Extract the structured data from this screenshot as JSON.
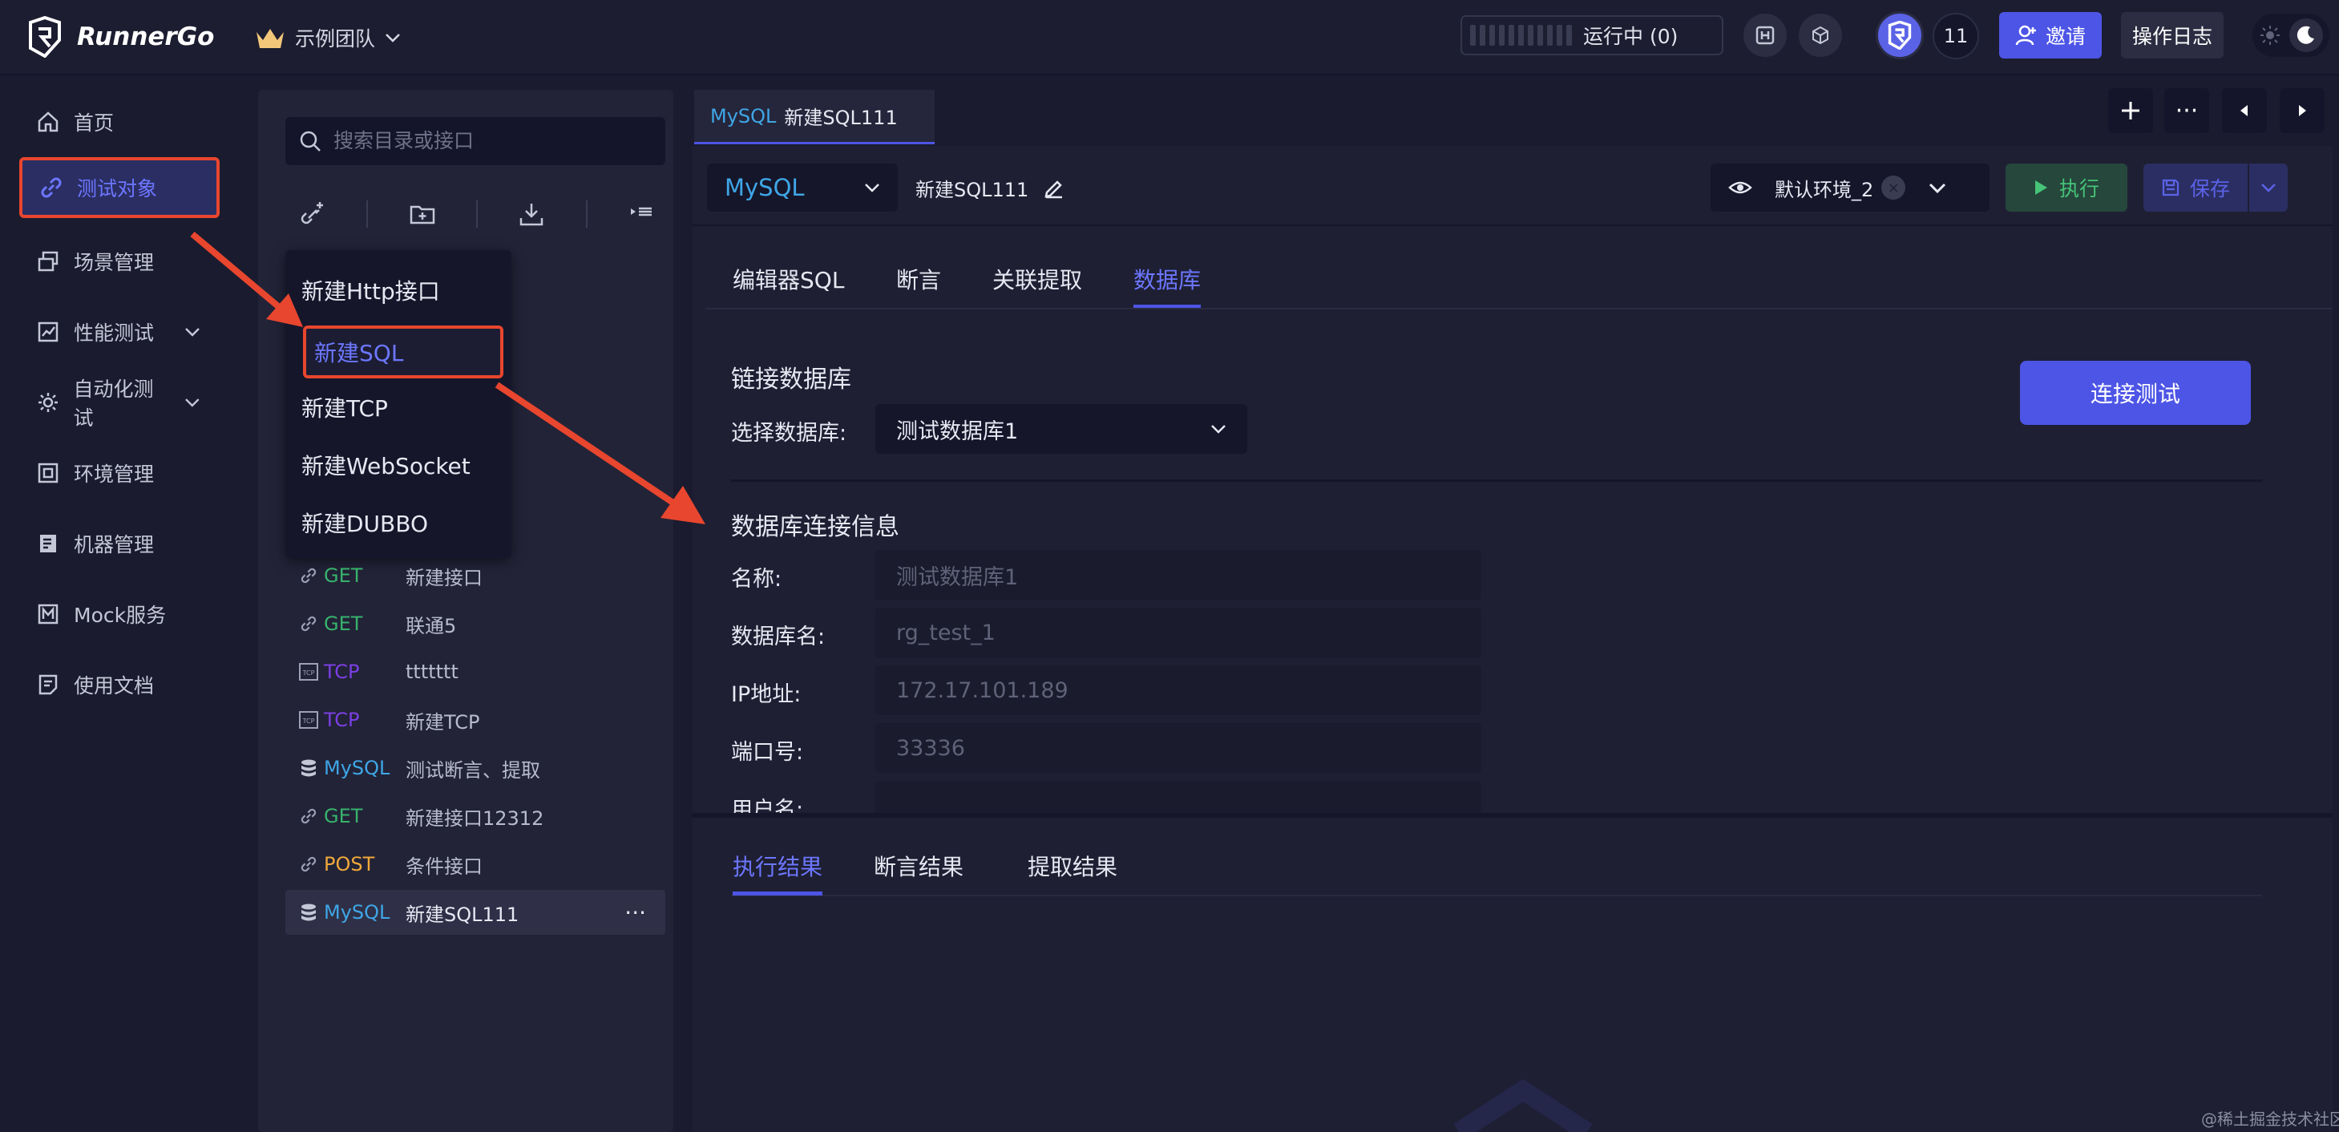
{
  "topbar": {
    "logo_text": "RunnerGo",
    "team_name": "示例团队",
    "run_status": "运行中 (0)",
    "member_count": "11",
    "invite_label": "邀请",
    "oplog_label": "操作日志"
  },
  "leftnav": {
    "items": [
      {
        "label": "首页",
        "icon": "home-icon"
      },
      {
        "label": "测试对象",
        "icon": "link-icon"
      },
      {
        "label": "场景管理",
        "icon": "layers-icon"
      },
      {
        "label": "性能测试",
        "icon": "chart-icon"
      },
      {
        "label": "自动化测试",
        "icon": "gear-icon"
      },
      {
        "label": "环境管理",
        "icon": "box-icon"
      },
      {
        "label": "机器管理",
        "icon": "server-icon"
      },
      {
        "label": "Mock服务",
        "icon": "mock-icon"
      },
      {
        "label": "使用文档",
        "icon": "doc-icon"
      }
    ]
  },
  "tree": {
    "search_placeholder": "搜索目录或接口",
    "menu": [
      "新建Http接口",
      "新建SQL",
      "新建TCP",
      "新建WebSocket",
      "新建DUBBO"
    ],
    "rows": [
      {
        "method": "GET",
        "name": "新建接口",
        "icon": "link-icon"
      },
      {
        "method": "GET",
        "name": "联通5",
        "icon": "link-icon"
      },
      {
        "method": "TCP",
        "name": "ttttttt",
        "icon": "tcp-icon"
      },
      {
        "method": "TCP",
        "name": "新建TCP",
        "icon": "tcp-icon"
      },
      {
        "method": "MySQL",
        "name": "测试断言、提取",
        "icon": "database-icon"
      },
      {
        "method": "GET",
        "name": "新建接口12312",
        "icon": "link-icon"
      },
      {
        "method": "POST",
        "name": "条件接口",
        "icon": "link-icon"
      },
      {
        "method": "MySQL",
        "name": "新建SQL111",
        "icon": "database-icon"
      }
    ]
  },
  "editor": {
    "tab": {
      "type": "MySQL",
      "name": "新建SQL111"
    },
    "db_type": "MySQL",
    "request_name": "新建SQL111",
    "env_name": "默认环境_2",
    "run_label": "执行",
    "save_label": "保存",
    "subtabs": [
      "编辑器SQL",
      "断言",
      "关联提取",
      "数据库"
    ],
    "link_title": "链接数据库",
    "choose_label": "选择数据库:",
    "choose_value": "测试数据库1",
    "connect_label": "连接测试",
    "info_title": "数据库连接信息",
    "fields": [
      {
        "label": "名称:",
        "value": "测试数据库1"
      },
      {
        "label": "数据库名:",
        "value": "rg_test_1"
      },
      {
        "label": "IP地址:",
        "value": "172.17.101.189"
      },
      {
        "label": "端口号:",
        "value": "33336"
      },
      {
        "label": "用户名:",
        "value": ""
      }
    ],
    "result_tabs": [
      "执行结果",
      "断言结果",
      "提取结果"
    ]
  },
  "watermark": "@稀土掘金技术社区",
  "colors": {
    "accent": "#4d55e6",
    "get": "#37b26c",
    "tcp": "#7b3fe4",
    "mysql": "#3fa6e6",
    "post": "#f0a93a",
    "annotation": "#e8462e"
  }
}
